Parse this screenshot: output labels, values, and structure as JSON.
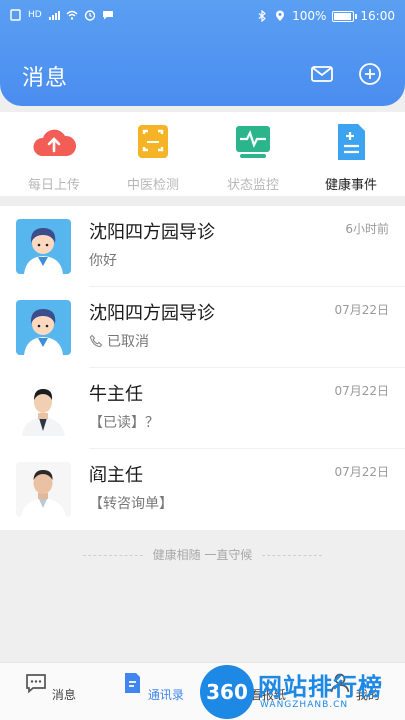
{
  "status_bar": {
    "network_label": "HD",
    "battery": "100%",
    "battery_level": 1.0,
    "time": "16:00"
  },
  "header": {
    "title": "消息",
    "mail_icon": "mail-icon",
    "add_icon": "plus-circle-icon"
  },
  "quick_actions": [
    {
      "label": "每日上传",
      "icon": "cloud-upload-icon"
    },
    {
      "label": "中医检测",
      "icon": "face-scan-icon"
    },
    {
      "label": "状态监控",
      "icon": "heart-monitor-icon"
    },
    {
      "label": "健康事件",
      "icon": "document-add-icon"
    }
  ],
  "messages": [
    {
      "name": "沈阳四方园导诊",
      "preview": "你好",
      "time": "6小时前",
      "avatar": "cartoon-doctor-avatar"
    },
    {
      "name": "沈阳四方园导诊",
      "preview": "已取消",
      "time": "07月22日",
      "avatar": "cartoon-doctor-avatar",
      "preview_icon": "phone-icon"
    },
    {
      "name": "牛主任",
      "preview": "【已读】？",
      "time": "07月22日",
      "avatar": "doctor-photo-avatar"
    },
    {
      "name": "阎主任",
      "preview": "【转咨询单】",
      "time": "07月22日",
      "avatar": "doctor-photo-avatar"
    }
  ],
  "slogan": "健康相随 一直守候",
  "tabs": [
    {
      "label": "消息",
      "icon": "chat-icon"
    },
    {
      "label": "通讯录",
      "icon": "contacts-icon"
    },
    {
      "label": "看报纸",
      "icon": "newspaper-icon"
    },
    {
      "label": "我的",
      "icon": "user-icon"
    }
  ],
  "watermark": {
    "badge": "360",
    "title": "网站排行榜",
    "subtitle": "WANGZHANB.CN"
  },
  "colors": {
    "primary": "#4a8df0",
    "tab_active": "#3f86f0",
    "watermark": "#1e88e5"
  }
}
